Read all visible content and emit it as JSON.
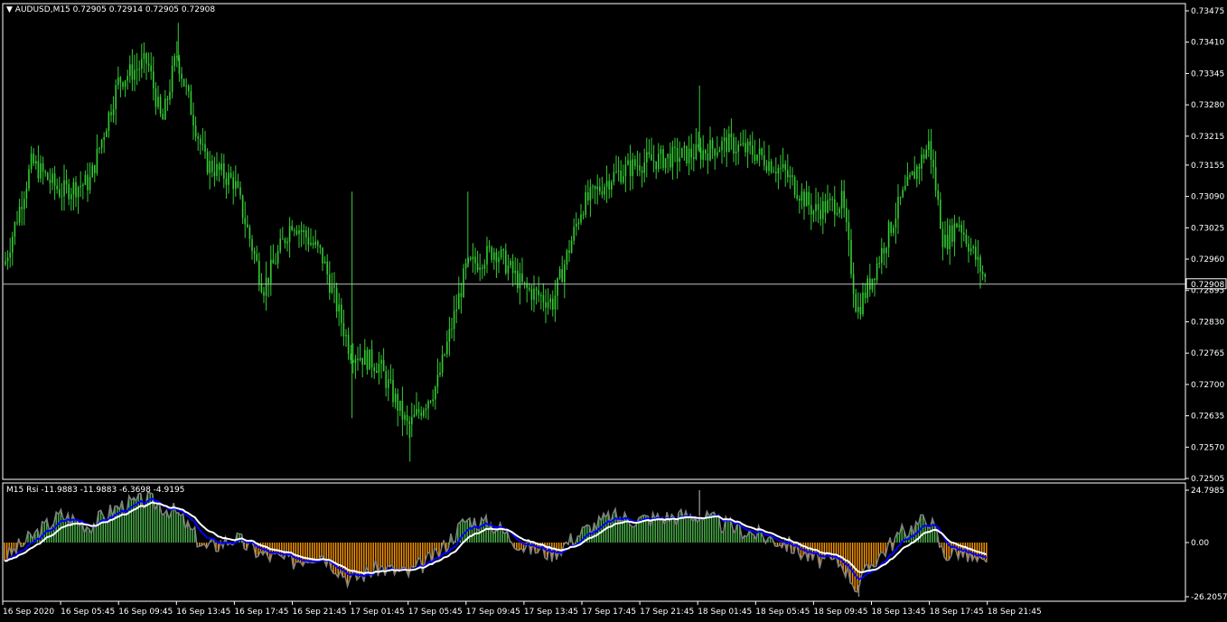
{
  "main_header": {
    "menu_glyph": "▼",
    "symbol": "AUDUSD,M15",
    "ohlc": "0.72905 0.72914 0.72905 0.72908"
  },
  "price_axis": {
    "labels": [
      "0.73475",
      "0.73410",
      "0.73345",
      "0.73280",
      "0.73215",
      "0.73155",
      "0.73090",
      "0.73025",
      "0.72960",
      "0.72895",
      "0.72830",
      "0.72765",
      "0.72700",
      "0.72635",
      "0.72570",
      "0.72505"
    ],
    "current_price": "0.72908"
  },
  "rsi_header": {
    "name": "M15 Rsi",
    "values": "-11.9883 -11.9883 -6.3698 -4.9195"
  },
  "rsi_axis": {
    "top": "24.7985",
    "mid": "0.00",
    "bottom": "-26.2057"
  },
  "time_axis": {
    "labels": [
      "16 Sep 2020",
      "16 Sep 05:45",
      "16 Sep 09:45",
      "16 Sep 13:45",
      "16 Sep 17:45",
      "16 Sep 21:45",
      "17 Sep 01:45",
      "17 Sep 05:45",
      "17 Sep 09:45",
      "17 Sep 13:45",
      "17 Sep 17:45",
      "17 Sep 21:45",
      "18 Sep 01:45",
      "18 Sep 05:45",
      "18 Sep 09:45",
      "18 Sep 13:45",
      "18 Sep 17:45",
      "18 Sep 21:45"
    ]
  },
  "colors": {
    "background": "#000000",
    "candles": "#33cc33",
    "frame": "#ffffff",
    "current_price_line": "#c0c0c0",
    "rsi_positive_bars": "#4cb84c",
    "rsi_negative_bars": "#ff9900",
    "rsi_raw_line": "#808080",
    "rsi_fast_line": "#0000ff",
    "rsi_slow_line": "#ffffff"
  },
  "chart_data": [
    {
      "type": "candlestick",
      "title": "AUDUSD,M15",
      "x_range": [
        "16 Sep 2020",
        "18 Sep 21:45"
      ],
      "ylim": [
        0.72505,
        0.73475
      ],
      "current_price": 0.72908,
      "close_path": [
        {
          "t": "16 Sep 2020",
          "y": 0.72935
        },
        {
          "t": "16 Sep 03:45",
          "y": 0.7316
        },
        {
          "t": "16 Sep 05:45",
          "y": 0.731
        },
        {
          "t": "16 Sep 07:45",
          "y": 0.7312
        },
        {
          "t": "16 Sep 09:45",
          "y": 0.7333
        },
        {
          "t": "16 Sep 11:45",
          "y": 0.7337
        },
        {
          "t": "16 Sep 12:45",
          "y": 0.7324
        },
        {
          "t": "16 Sep 13:45",
          "y": 0.73385
        },
        {
          "t": "16 Sep 15:45",
          "y": 0.7316
        },
        {
          "t": "16 Sep 17:45",
          "y": 0.7312
        },
        {
          "t": "16 Sep 19:45",
          "y": 0.729
        },
        {
          "t": "16 Sep 21:45",
          "y": 0.7304
        },
        {
          "t": "16 Sep 23:45",
          "y": 0.7297
        },
        {
          "t": "17 Sep 01:45",
          "y": 0.7277
        },
        {
          "t": "17 Sep 03:45",
          "y": 0.7274
        },
        {
          "t": "17 Sep 05:45",
          "y": 0.7261
        },
        {
          "t": "17 Sep 07:45",
          "y": 0.727
        },
        {
          "t": "17 Sep 09:45",
          "y": 0.7294
        },
        {
          "t": "17 Sep 11:45",
          "y": 0.7298
        },
        {
          "t": "17 Sep 13:45",
          "y": 0.729
        },
        {
          "t": "17 Sep 15:45",
          "y": 0.7287
        },
        {
          "t": "17 Sep 17:45",
          "y": 0.7307
        },
        {
          "t": "17 Sep 19:45",
          "y": 0.7313
        },
        {
          "t": "17 Sep 21:45",
          "y": 0.7316
        },
        {
          "t": "18 Sep 01:45",
          "y": 0.7318
        },
        {
          "t": "18 Sep 03:45",
          "y": 0.732
        },
        {
          "t": "18 Sep 05:45",
          "y": 0.7318
        },
        {
          "t": "18 Sep 07:45",
          "y": 0.7314
        },
        {
          "t": "18 Sep 09:45",
          "y": 0.7306
        },
        {
          "t": "18 Sep 11:45",
          "y": 0.7308
        },
        {
          "t": "18 Sep 12:45",
          "y": 0.7285
        },
        {
          "t": "18 Sep 13:45",
          "y": 0.7292
        },
        {
          "t": "18 Sep 15:45",
          "y": 0.7308
        },
        {
          "t": "18 Sep 17:45",
          "y": 0.732
        },
        {
          "t": "18 Sep 18:45",
          "y": 0.7299
        },
        {
          "t": "18 Sep 19:45",
          "y": 0.7304
        },
        {
          "t": "18 Sep 21:45",
          "y": 0.72908
        }
      ],
      "spikes": [
        {
          "t": "16 Sep 13:45",
          "high": 0.7345
        },
        {
          "t": "16 Sep 15:45",
          "low": 0.7314
        },
        {
          "t": "17 Sep 01:45",
          "high": 0.731
        },
        {
          "t": "17 Sep 01:45",
          "low": 0.7263
        },
        {
          "t": "17 Sep 05:45",
          "low": 0.7254
        },
        {
          "t": "17 Sep 09:45",
          "high": 0.731
        },
        {
          "t": "18 Sep 01:45",
          "high": 0.7332
        },
        {
          "t": "18 Sep 17:45",
          "high": 0.7323
        }
      ]
    },
    {
      "type": "bar",
      "title": "M15 Rsi",
      "ylim": [
        -26.2057,
        24.7985
      ],
      "current_values": [
        -11.9883,
        -11.9883,
        -6.3698,
        -4.9195
      ],
      "path": [
        {
          "t": "16 Sep 2020",
          "v": -8
        },
        {
          "t": "16 Sep 05:45",
          "v": 13
        },
        {
          "t": "16 Sep 07:45",
          "v": 8
        },
        {
          "t": "16 Sep 09:45",
          "v": 17
        },
        {
          "t": "16 Sep 11:45",
          "v": 20
        },
        {
          "t": "16 Sep 13:45",
          "v": 14
        },
        {
          "t": "16 Sep 15:45",
          "v": -3
        },
        {
          "t": "16 Sep 17:45",
          "v": 2
        },
        {
          "t": "16 Sep 19:45",
          "v": -6
        },
        {
          "t": "16 Sep 21:45",
          "v": -9
        },
        {
          "t": "16 Sep 23:45",
          "v": -5
        },
        {
          "t": "17 Sep 01:45",
          "v": -18
        },
        {
          "t": "17 Sep 03:45",
          "v": -12
        },
        {
          "t": "17 Sep 05:45",
          "v": -15
        },
        {
          "t": "17 Sep 07:45",
          "v": -6
        },
        {
          "t": "17 Sep 09:45",
          "v": 11
        },
        {
          "t": "17 Sep 11:45",
          "v": 8
        },
        {
          "t": "17 Sep 13:45",
          "v": -2
        },
        {
          "t": "17 Sep 15:45",
          "v": -5
        },
        {
          "t": "17 Sep 17:45",
          "v": 5
        },
        {
          "t": "17 Sep 19:45",
          "v": 12
        },
        {
          "t": "17 Sep 21:45",
          "v": 11
        },
        {
          "t": "18 Sep 01:45",
          "v": 13
        },
        {
          "t": "18 Sep 03:45",
          "v": 8
        },
        {
          "t": "18 Sep 05:45",
          "v": 4
        },
        {
          "t": "18 Sep 07:45",
          "v": 0
        },
        {
          "t": "18 Sep 09:45",
          "v": -8
        },
        {
          "t": "18 Sep 11:45",
          "v": -10
        },
        {
          "t": "18 Sep 12:45",
          "v": -22
        },
        {
          "t": "18 Sep 13:45",
          "v": -10
        },
        {
          "t": "18 Sep 15:45",
          "v": 4
        },
        {
          "t": "18 Sep 17:45",
          "v": 12
        },
        {
          "t": "18 Sep 18:45",
          "v": -6
        },
        {
          "t": "18 Sep 19:45",
          "v": -4
        },
        {
          "t": "18 Sep 21:45",
          "v": -12
        }
      ],
      "spikes": [
        {
          "t": "18 Sep 01:45",
          "v": 24.7985
        },
        {
          "t": "18 Sep 12:45",
          "v": -26.2057
        }
      ]
    }
  ]
}
